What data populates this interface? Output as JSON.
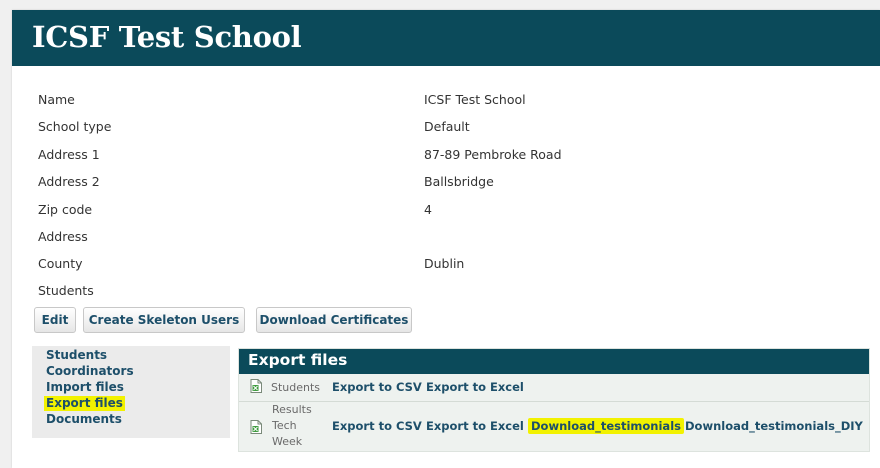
{
  "header": {
    "title": "ICSF Test School"
  },
  "details": [
    {
      "label": "Name",
      "value": "ICSF Test School"
    },
    {
      "label": "School type",
      "value": "Default"
    },
    {
      "label": "Address 1",
      "value": "87-89 Pembroke Road"
    },
    {
      "label": "Address 2",
      "value": "Ballsbridge"
    },
    {
      "label": "Zip code",
      "value": "4"
    },
    {
      "label": "Address",
      "value": ""
    },
    {
      "label": "County",
      "value": "Dublin"
    },
    {
      "label": "Students",
      "value": ""
    }
  ],
  "actions": {
    "edit": "Edit",
    "create_skeleton_users": "Create Skeleton Users",
    "download_certificates": "Download Certificates"
  },
  "sidebar": {
    "items": [
      {
        "label": "Students",
        "highlighted": false
      },
      {
        "label": "Coordinators",
        "highlighted": false
      },
      {
        "label": "Import files",
        "highlighted": false
      },
      {
        "label": "Export files",
        "highlighted": true
      },
      {
        "label": "Documents",
        "highlighted": false
      }
    ]
  },
  "export_panel": {
    "title": "Export files",
    "rows": [
      {
        "icon": "excel-file-icon",
        "name": "Students",
        "links": [
          "Export to CSV",
          "Export to Excel"
        ]
      },
      {
        "icon": "excel-file-icon",
        "name_lines": [
          "Results",
          "Tech",
          "Week"
        ],
        "links": [
          "Export to CSV",
          "Export to Excel",
          "Download_testimonials",
          "Download_testimonials_DIY"
        ],
        "highlighted_link": "Download_testimonials"
      }
    ]
  },
  "colors": {
    "header_bg": "#0b4a5a",
    "link": "#1d4f6a",
    "highlight": "#f2f200",
    "panel_bg": "#eef2ef"
  }
}
